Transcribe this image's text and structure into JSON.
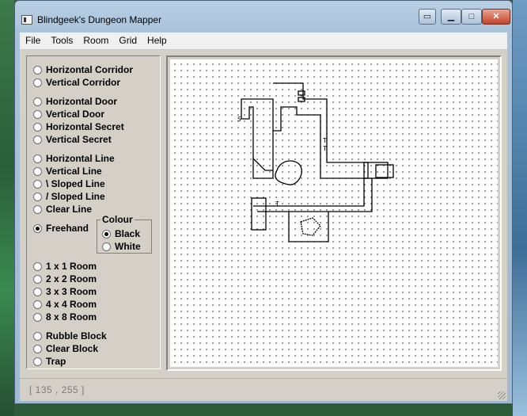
{
  "window": {
    "title": "Blindgeek's Dungeon Mapper",
    "buttons": {
      "minimize_icon": "minimize-icon",
      "maximize_icon": "maximize-icon",
      "close_icon": "close-icon"
    }
  },
  "menu": [
    "File",
    "Tools",
    "Room",
    "Grid",
    "Help"
  ],
  "tools": [
    {
      "label": "Horizontal Corridor",
      "checked": false
    },
    {
      "label": "Vertical Corridor",
      "checked": false
    },
    {
      "label": "Horizontal Door",
      "checked": false
    },
    {
      "label": "Vertical Door",
      "checked": false
    },
    {
      "label": "Horizontal Secret",
      "checked": false
    },
    {
      "label": "Vertical Secret",
      "checked": false
    },
    {
      "label": "Horizontal Line",
      "checked": false
    },
    {
      "label": "Vertical Line",
      "checked": false
    },
    {
      "label": "\\ Sloped Line",
      "checked": false
    },
    {
      "label": "/ Sloped Line",
      "checked": false
    },
    {
      "label": "Clear Line",
      "checked": false
    },
    {
      "label": "Freehand",
      "checked": true
    },
    {
      "label": "1 x 1 Room",
      "checked": false
    },
    {
      "label": "2 x 2 Room",
      "checked": false
    },
    {
      "label": "3 x 3 Room",
      "checked": false
    },
    {
      "label": "4 x 4 Room",
      "checked": false
    },
    {
      "label": "8 x 8 Room",
      "checked": false
    },
    {
      "label": "Rubble Block",
      "checked": false
    },
    {
      "label": "Clear Block",
      "checked": false
    },
    {
      "label": "Trap",
      "checked": false
    }
  ],
  "colour": {
    "legend": "Colour",
    "options": [
      {
        "label": "Black",
        "checked": true
      },
      {
        "label": "White",
        "checked": false
      }
    ]
  },
  "status": {
    "coords": "[ 135 , 255 ]"
  }
}
